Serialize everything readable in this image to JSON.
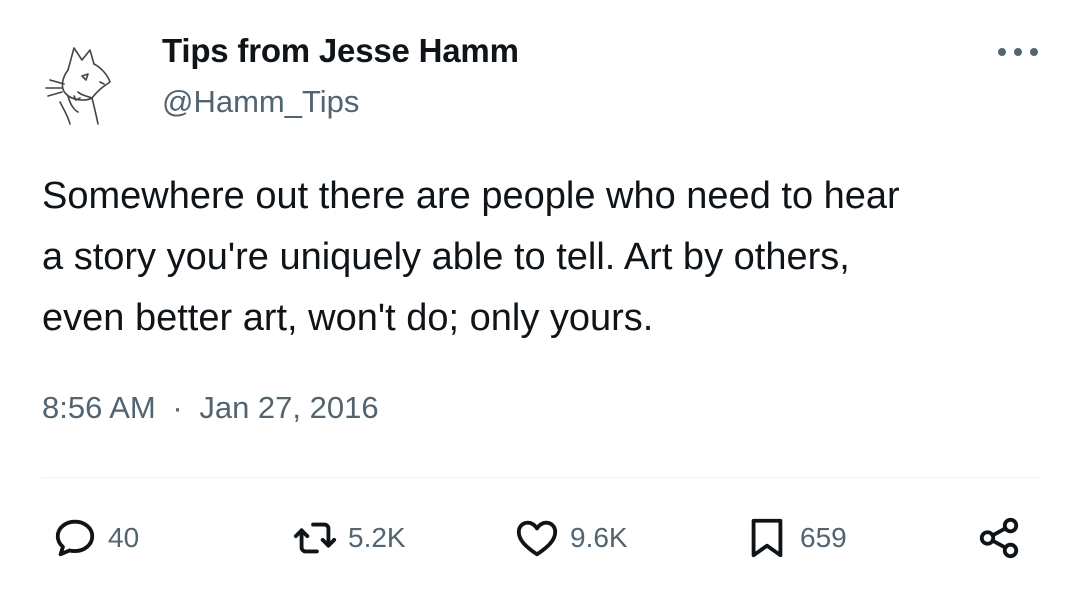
{
  "author": {
    "display_name": "Tips from Jesse Hamm",
    "handle": "@Hamm_Tips",
    "avatar_icon": "cat-sketch-avatar"
  },
  "tweet": {
    "lines": [
      "Somewhere out there are people who need to hear",
      "a story you're uniquely able to tell. Art by others,",
      "even better art, won't do; only yours."
    ],
    "time": "8:56 AM",
    "separator": "·",
    "date": "Jan 27, 2016"
  },
  "actions": {
    "replies": {
      "icon": "reply-icon",
      "count": "40"
    },
    "retweets": {
      "icon": "retweet-icon",
      "count": "5.2K"
    },
    "likes": {
      "icon": "heart-icon",
      "count": "9.6K"
    },
    "bookmarks": {
      "icon": "bookmark-icon",
      "count": "659"
    },
    "share": {
      "icon": "share-icon"
    }
  },
  "more_menu": {
    "icon": "more-dots-icon"
  },
  "colors": {
    "text": "#0f1419",
    "secondary": "#536471",
    "divider": "#eff3f4",
    "background": "#ffffff"
  }
}
